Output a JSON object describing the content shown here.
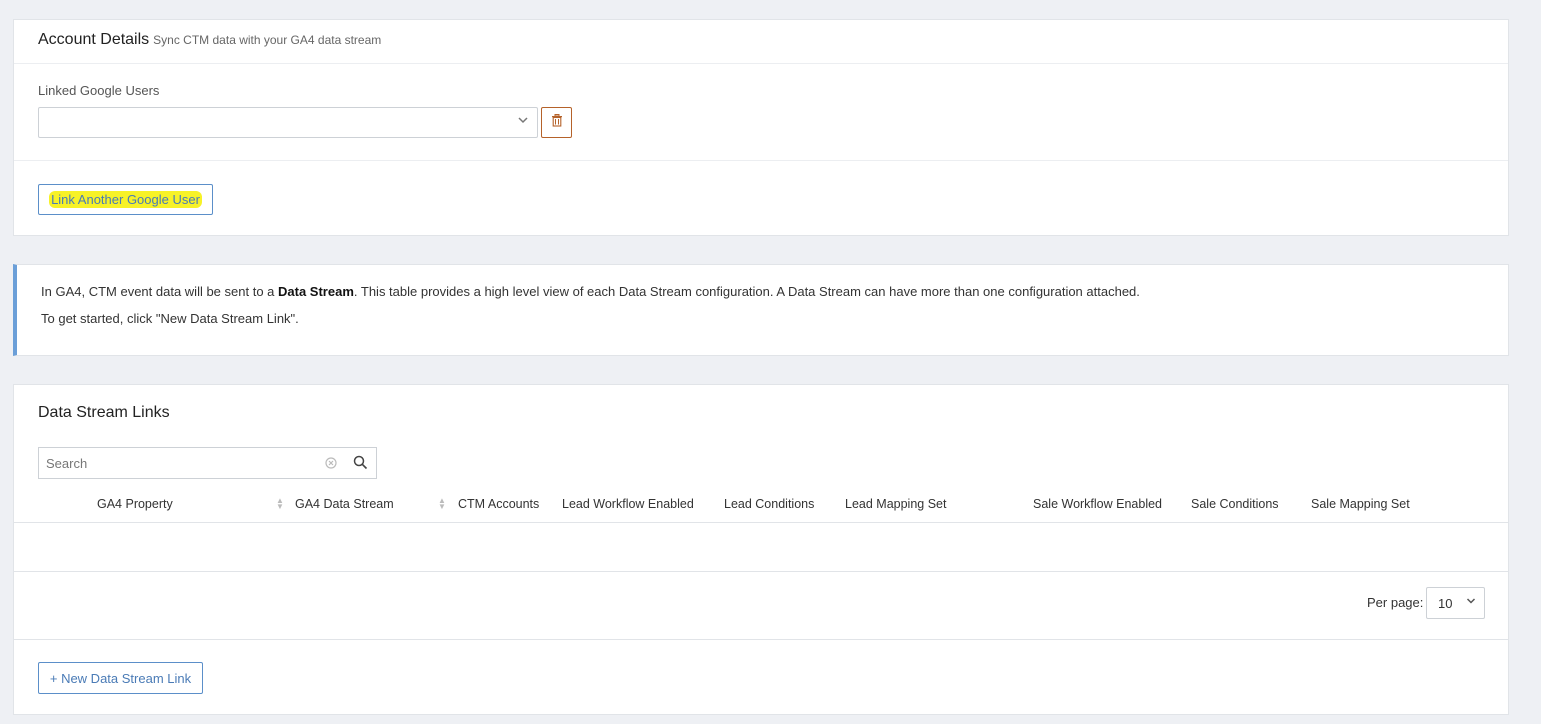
{
  "account": {
    "title": "Account Details",
    "subtitle": "Sync CTM data with your GA4 data stream",
    "linked_label": "Linked Google Users",
    "linked_select_value": "",
    "link_another_label": "Link Another Google User"
  },
  "info": {
    "line1_pre": "In GA4, CTM event data will be sent to a ",
    "line1_bold": "Data Stream",
    "line1_post": ". This table provides a high level view of each Data Stream configuration. A Data Stream can have more than one configuration attached.",
    "line2": "To get started, click \"New Data Stream Link\"."
  },
  "streams": {
    "title": "Data Stream Links",
    "search_placeholder": "Search",
    "columns": [
      "GA4 Property",
      "GA4 Data Stream",
      "CTM Accounts",
      "Lead Workflow Enabled",
      "Lead Conditions",
      "Lead Mapping Set",
      "Sale Workflow Enabled",
      "Sale Conditions",
      "Sale Mapping Set"
    ],
    "per_page_label": "Per page:",
    "per_page_value": "10",
    "new_link_label": "+ New Data Stream Link"
  },
  "colors": {
    "primary_blue": "#4a7bb6",
    "danger_brown": "#b5622a",
    "highlight_yellow": "#f7f227",
    "info_border": "#6b9fd8"
  },
  "icons": [
    "chevron-down-icon",
    "trash-icon",
    "clear-icon",
    "search-icon",
    "sort-icon"
  ]
}
